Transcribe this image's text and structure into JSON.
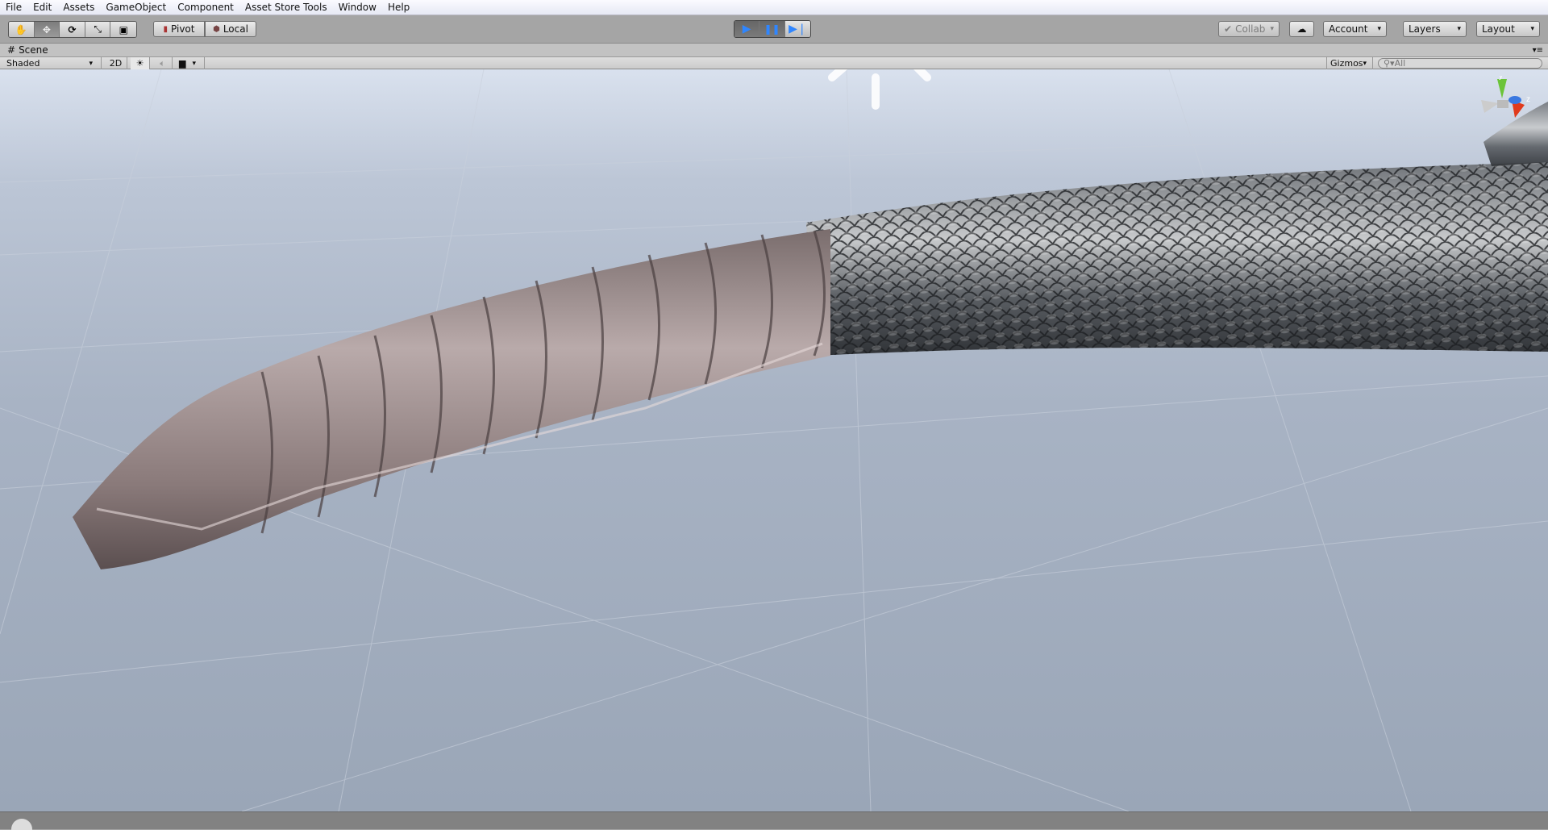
{
  "menu": [
    "File",
    "Edit",
    "Assets",
    "GameObject",
    "Component",
    "Asset Store Tools",
    "Window",
    "Help"
  ],
  "toolbar": {
    "tools": [
      "hand-tool",
      "move-tool",
      "rotate-tool",
      "scale-tool",
      "rect-tool"
    ],
    "active_tool": "move-tool",
    "pivot": "Pivot",
    "local": "Local",
    "collab": "Collab",
    "account": "Account",
    "layers": "Layers",
    "layout": "Layout"
  },
  "playback": {
    "play": "play",
    "pause": "pause",
    "step": "step",
    "step_active": true
  },
  "scene": {
    "tab": "Scene",
    "shading": "Shaded",
    "mode_2d": "2D",
    "gizmos": "Gizmos",
    "search_placeholder": "All"
  },
  "gizmo_axes": {
    "y": "y",
    "z": "z",
    "colors": {
      "x": "#e03a1c",
      "y": "#6cc43a",
      "z": "#3a78e0"
    }
  }
}
